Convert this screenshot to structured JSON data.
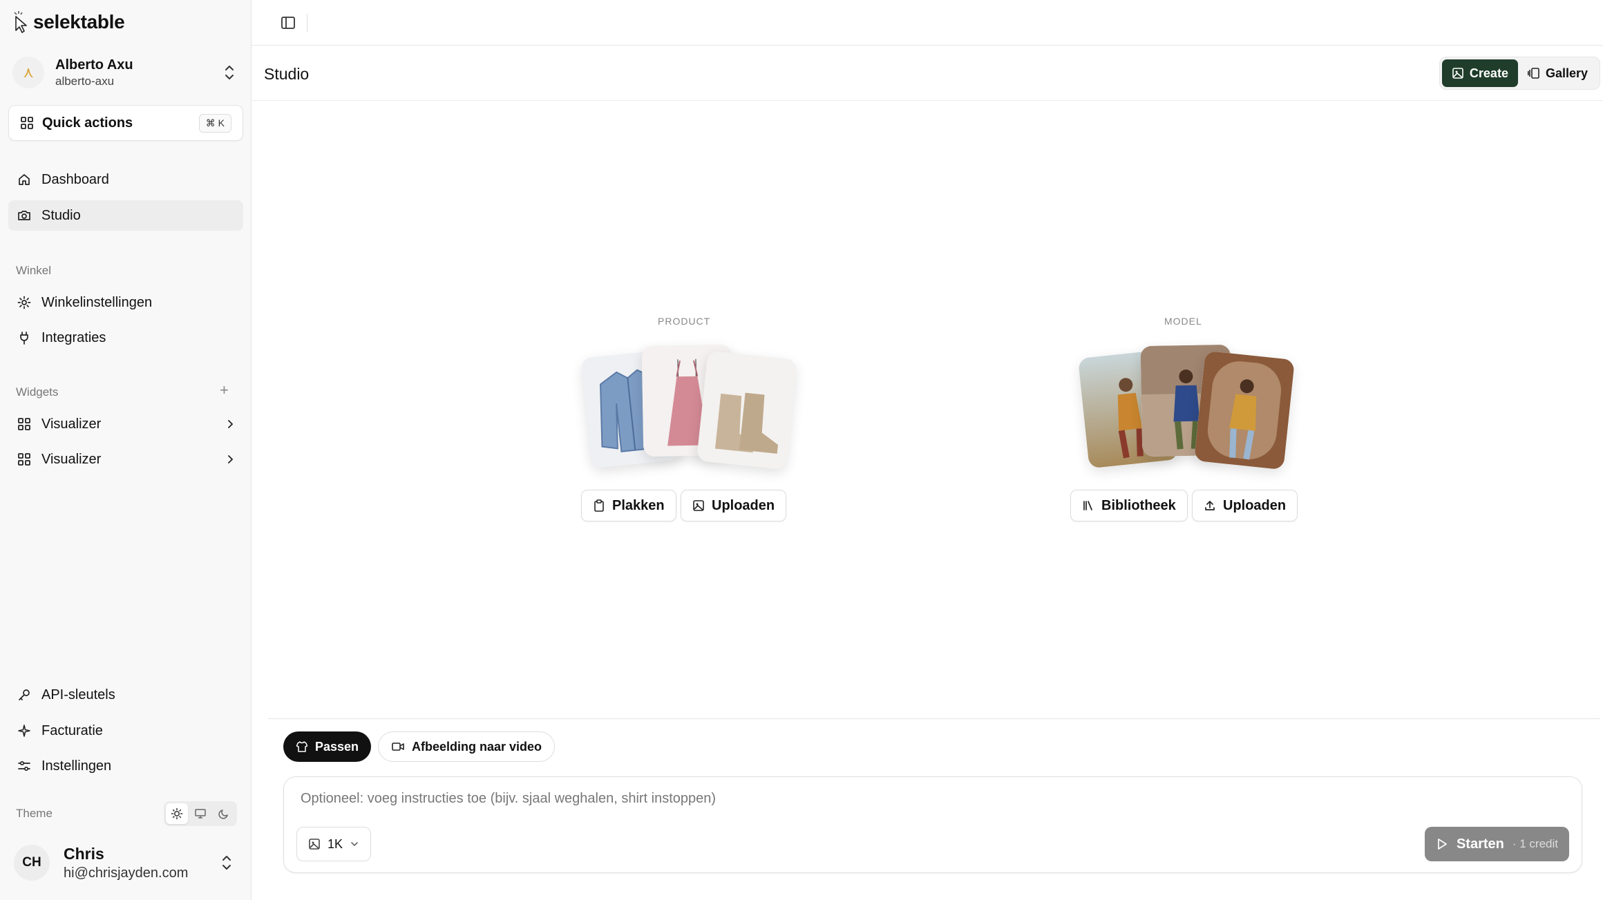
{
  "brand": {
    "name": "selektable"
  },
  "org": {
    "avatar": "⋏",
    "name": "Alberto Axu",
    "handle": "alberto-axu"
  },
  "quick_actions": {
    "label": "Quick actions",
    "shortcut": "⌘ K"
  },
  "nav": {
    "dashboard": "Dashboard",
    "studio": "Studio",
    "shop_section": "Winkel",
    "shop_settings": "Winkelinstellingen",
    "integrations": "Integraties",
    "widgets_section": "Widgets",
    "widgets": [
      {
        "label": "Visualizer"
      },
      {
        "label": "Visualizer"
      }
    ],
    "api_keys": "API-sleutels",
    "billing": "Facturatie",
    "settings": "Instellingen"
  },
  "theme": {
    "label": "Theme",
    "selected": "light"
  },
  "user": {
    "initials": "CH",
    "name": "Chris",
    "email": "hi@chrisjayden.com"
  },
  "header": {
    "title": "Studio",
    "create_label": "Create",
    "gallery_label": "Gallery"
  },
  "product": {
    "label": "PRODUCT",
    "paste_label": "Plakken",
    "upload_label": "Uploaden"
  },
  "model": {
    "label": "MODEL",
    "library_label": "Bibliotheek",
    "upload_label": "Uploaden"
  },
  "modes": {
    "fit_label": "Passen",
    "video_label": "Afbeelding naar video",
    "selected": "fit"
  },
  "prompt": {
    "placeholder": "Optioneel: voeg instructies toe (bijv. sjaal weghalen, shirt instoppen)",
    "resolution": "1K",
    "start_label": "Starten",
    "credit_label": "· 1 credit"
  },
  "colors": {
    "accent": "#1f3d2a",
    "start_disabled": "#888888"
  }
}
